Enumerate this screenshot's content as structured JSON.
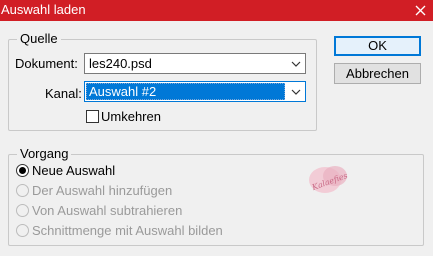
{
  "window": {
    "title": "Auswahl laden",
    "close_glyph": "✕",
    "titlebar_color": "#d11e25"
  },
  "source": {
    "legend": "Quelle",
    "document_label": "Dokument:",
    "document_value": "les240.psd",
    "channel_label": "Kanal:",
    "channel_value": "Auswahl #2",
    "invert_label": "Umkehren",
    "invert_checked": false
  },
  "operation": {
    "legend": "Vorgang",
    "options": [
      {
        "label": "Neue Auswahl",
        "selected": true,
        "enabled": true
      },
      {
        "label": "Der Auswahl hinzufügen",
        "selected": false,
        "enabled": false
      },
      {
        "label": "Von Auswahl subtrahieren",
        "selected": false,
        "enabled": false
      },
      {
        "label": "Schnittmenge mit Auswahl bilden",
        "selected": false,
        "enabled": false
      }
    ]
  },
  "buttons": {
    "ok": "OK",
    "cancel": "Abbrechen"
  },
  "watermark": {
    "text": "Kalaefies",
    "color": "#e8a6b6"
  },
  "colors": {
    "accent": "#0078d7",
    "dialog_bg": "#f0f0f0",
    "disabled_text": "#9a9a9a"
  }
}
